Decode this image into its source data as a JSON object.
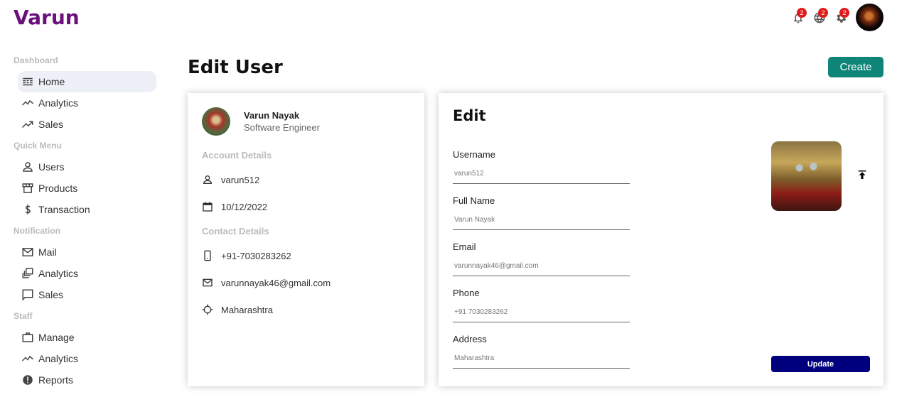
{
  "app": {
    "logo": "Varun"
  },
  "topbar": {
    "notifications_badge": "2",
    "language_badge": "2",
    "settings_badge": "2"
  },
  "sidebar": {
    "sections": [
      {
        "title": "Dashboard",
        "items": [
          {
            "label": "Home",
            "icon": "home-icon"
          },
          {
            "label": "Analytics",
            "icon": "timeline-icon"
          },
          {
            "label": "Sales",
            "icon": "trending-up-icon"
          }
        ]
      },
      {
        "title": "Quick Menu",
        "items": [
          {
            "label": "Users",
            "icon": "user-icon"
          },
          {
            "label": "Products",
            "icon": "storefront-icon"
          },
          {
            "label": "Transaction",
            "icon": "dollar-icon"
          }
        ]
      },
      {
        "title": "Notification",
        "items": [
          {
            "label": "Mail",
            "icon": "mail-icon"
          },
          {
            "label": "Analytics",
            "icon": "dynamic-feed-icon"
          },
          {
            "label": "Sales",
            "icon": "chat-bubble-icon"
          }
        ]
      },
      {
        "title": "Staff",
        "items": [
          {
            "label": "Manage",
            "icon": "briefcase-icon"
          },
          {
            "label": "Analytics",
            "icon": "timeline-icon"
          },
          {
            "label": "Reports",
            "icon": "report-icon"
          }
        ]
      }
    ]
  },
  "page": {
    "title": "Edit User",
    "create_label": "Create"
  },
  "show": {
    "name": "Varun Nayak",
    "role": "Software Engineer",
    "account_title": "Account Details",
    "username": "varun512",
    "birthday": "10/12/2022",
    "contact_title": "Contact Details",
    "phone": "+91-7030283262",
    "email": "varunnayak46@gmail.com",
    "address": "Maharashtra"
  },
  "edit": {
    "title": "Edit",
    "fields": [
      {
        "label": "Username",
        "placeholder": "varun512"
      },
      {
        "label": "Full Name",
        "placeholder": "Varun Nayak"
      },
      {
        "label": "Email",
        "placeholder": "varunnayak46@gmail.com"
      },
      {
        "label": "Phone",
        "placeholder": "+91 7030283262"
      },
      {
        "label": "Address",
        "placeholder": "Maharashtra"
      }
    ],
    "update_label": "Update"
  },
  "colors": {
    "logo": "#6b0f7d",
    "create_button": "#0f857a",
    "update_button": "#00007e",
    "badge": "#e01b1b",
    "active_sidebar": "#eef0f7"
  }
}
